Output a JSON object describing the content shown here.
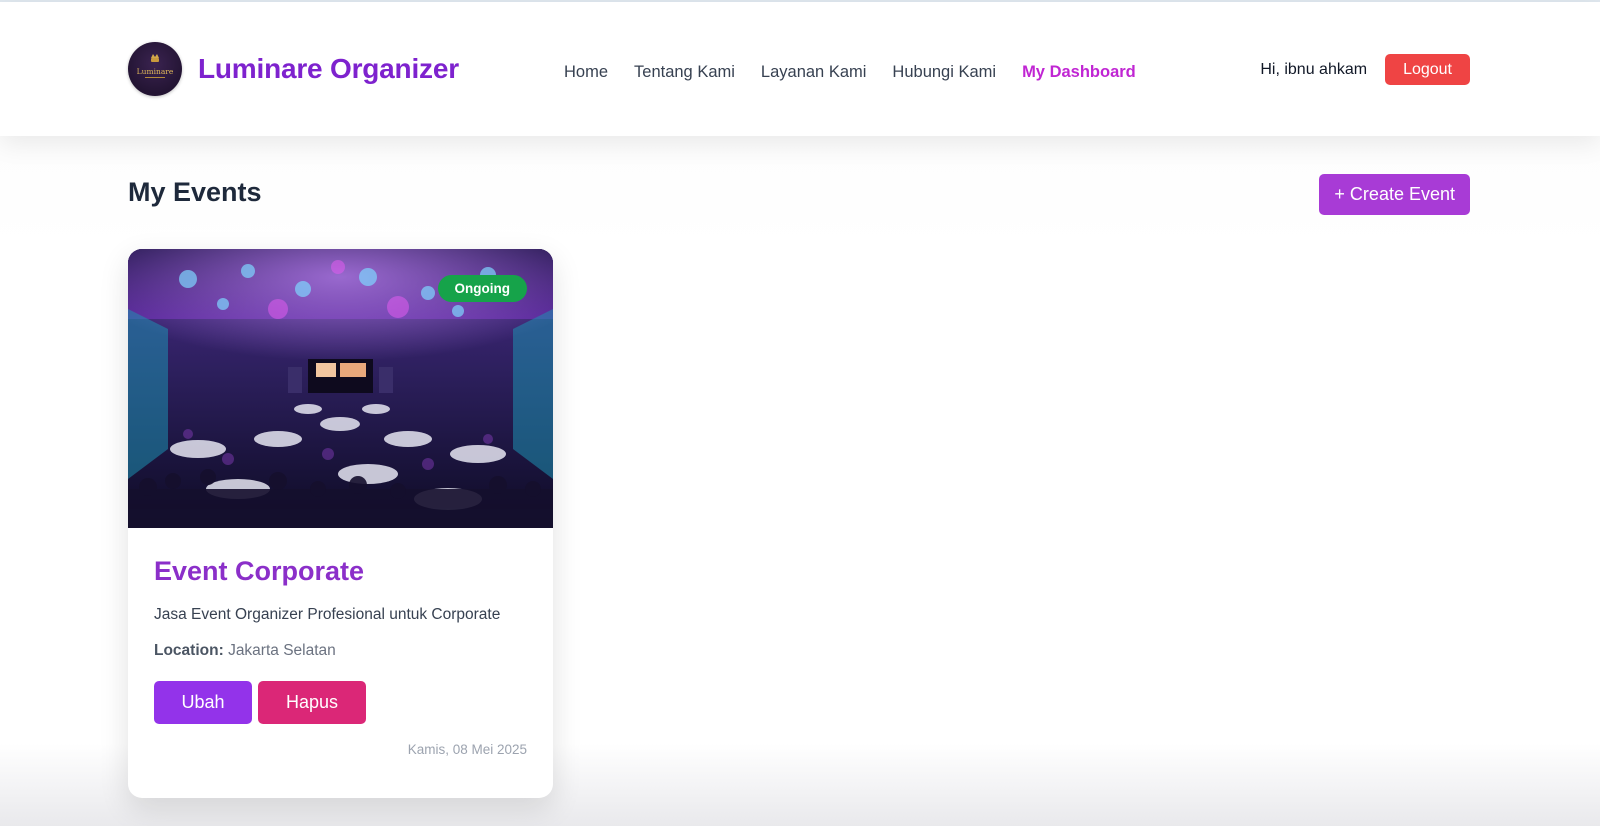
{
  "brand": {
    "name": "Luminare Organizer",
    "logo_text": "Luminare",
    "logo_icon": "crown-emblem-icon"
  },
  "nav": {
    "items": [
      {
        "label": "Home",
        "active": false
      },
      {
        "label": "Tentang Kami",
        "active": false
      },
      {
        "label": "Layanan Kami",
        "active": false
      },
      {
        "label": "Hubungi Kami",
        "active": false
      },
      {
        "label": "My Dashboard",
        "active": true
      }
    ]
  },
  "user": {
    "greeting": "Hi, ibnu ahkam",
    "logout_label": "Logout"
  },
  "main": {
    "title": "My Events",
    "create_label": "+ Create Event"
  },
  "events": [
    {
      "status": "Ongoing",
      "title": "Event Corporate",
      "description": "Jasa Event Organizer Profesional untuk Corporate",
      "location_label": "Location:",
      "location": "Jakarta Selatan",
      "edit_label": "Ubah",
      "delete_label": "Hapus",
      "date": "Kamis, 08 Mei 2025"
    }
  ],
  "colors": {
    "brand": "#7e22ce",
    "nav_active": "#c026d3",
    "logout": "#ef4444",
    "create": "#a83bd6",
    "status_ongoing": "#16a34a",
    "edit": "#9333ea",
    "delete": "#db2777"
  }
}
